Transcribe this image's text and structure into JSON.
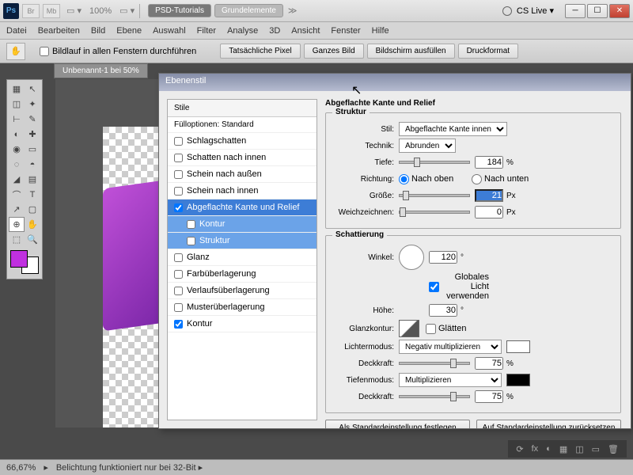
{
  "titlebar": {
    "br": "Br",
    "mb": "Mb",
    "zoom": "100%",
    "screen_mode": "▭ ▾",
    "tabs": [
      "PSD-Tutorials",
      "Grundelemente"
    ],
    "more": "≫",
    "cslive": "CS Live ▾"
  },
  "menubar": [
    "Datei",
    "Bearbeiten",
    "Bild",
    "Ebene",
    "Auswahl",
    "Filter",
    "Analyse",
    "3D",
    "Ansicht",
    "Fenster",
    "Hilfe"
  ],
  "optbar": {
    "scroll_all": "Bildlauf in allen Fenstern durchführen",
    "btns": [
      "Tatsächliche Pixel",
      "Ganzes Bild",
      "Bildschirm ausfüllen",
      "Druckformat"
    ]
  },
  "doctab": "Unbenannt-1 bei 50%",
  "dialog": {
    "title": "Ebenenstil",
    "styles_head": "Stile",
    "fill_head": "Fülloptionen: Standard",
    "items": [
      {
        "label": "Schlagschatten",
        "checked": false
      },
      {
        "label": "Schatten nach innen",
        "checked": false
      },
      {
        "label": "Schein nach außen",
        "checked": false
      },
      {
        "label": "Schein nach innen",
        "checked": false
      },
      {
        "label": "Abgeflachte Kante und Relief",
        "checked": true,
        "selected": true
      },
      {
        "label": "Kontur",
        "checked": false,
        "sub": true
      },
      {
        "label": "Struktur",
        "checked": false,
        "sub": true
      },
      {
        "label": "Glanz",
        "checked": false
      },
      {
        "label": "Farbüberlagerung",
        "checked": false
      },
      {
        "label": "Verlaufsüberlagerung",
        "checked": false
      },
      {
        "label": "Musterüberlagerung",
        "checked": false
      },
      {
        "label": "Kontur",
        "checked": true
      }
    ],
    "panel_title": "Abgeflachte Kante und Relief",
    "struktur": {
      "title": "Struktur",
      "stil": {
        "label": "Stil:",
        "value": "Abgeflachte Kante innen"
      },
      "technik": {
        "label": "Technik:",
        "value": "Abrunden"
      },
      "tiefe": {
        "label": "Tiefe:",
        "value": "184",
        "unit": "%"
      },
      "richtung": {
        "label": "Richtung:",
        "up": "Nach oben",
        "down": "Nach unten"
      },
      "groesse": {
        "label": "Größe:",
        "value": "21",
        "unit": "Px"
      },
      "weich": {
        "label": "Weichzeichnen:",
        "value": "0",
        "unit": "Px"
      }
    },
    "schattierung": {
      "title": "Schattierung",
      "winkel": {
        "label": "Winkel:",
        "value": "120",
        "unit": "°"
      },
      "global": "Globales Licht verwenden",
      "hoehe": {
        "label": "Höhe:",
        "value": "30",
        "unit": "°"
      },
      "glanzkontur": {
        "label": "Glanzkontur:",
        "smooth": "Glätten"
      },
      "lichter": {
        "label": "Lichtermodus:",
        "value": "Negativ multiplizieren"
      },
      "deck1": {
        "label": "Deckkraft:",
        "value": "75",
        "unit": "%"
      },
      "tiefen": {
        "label": "Tiefenmodus:",
        "value": "Multiplizieren"
      },
      "deck2": {
        "label": "Deckkraft:",
        "value": "75",
        "unit": "%"
      }
    },
    "default_btn": "Als Standardeinstellung festlegen",
    "reset_btn": "Auf Standardeinstellung zurücksetzen"
  },
  "status": {
    "zoom": "66,67%",
    "msg": "Belichtung funktioniert nur bei 32-Bit ▸"
  },
  "tools_grid": [
    [
      "▦",
      "↖"
    ],
    [
      "◫",
      "✦"
    ],
    [
      "⊢",
      "✎"
    ],
    [
      "◐",
      "✚"
    ],
    [
      "◉",
      "▭"
    ],
    [
      "◌",
      "◓"
    ],
    [
      "◢",
      "▤"
    ],
    [
      "⌒",
      "T"
    ],
    [
      "↗",
      "▢"
    ],
    [
      "⊕",
      "✋"
    ],
    [
      "⬚",
      "🔍"
    ]
  ],
  "footer_icons": [
    "⟳",
    "fx",
    "◐",
    "▦",
    "◫",
    "▭",
    "🗑"
  ]
}
